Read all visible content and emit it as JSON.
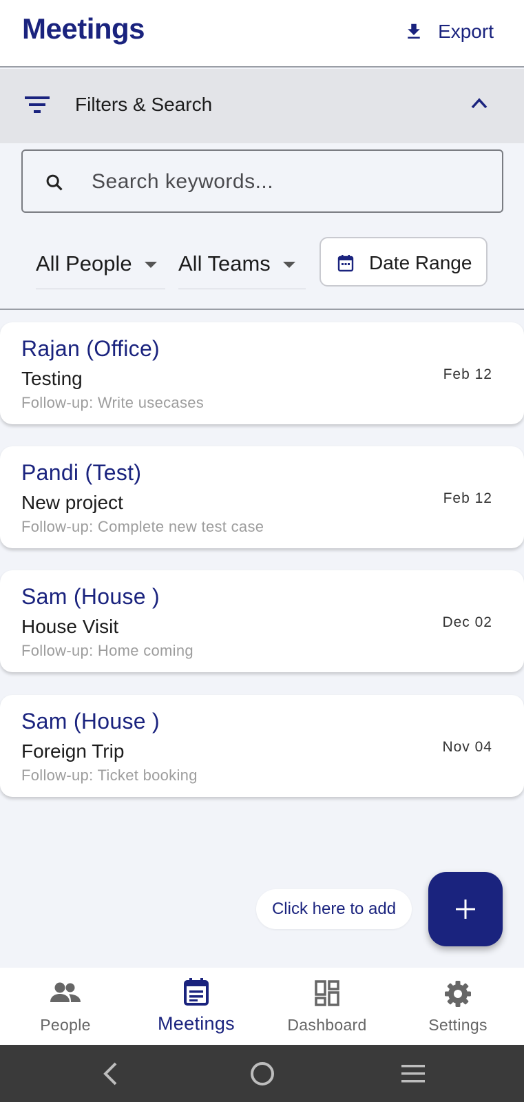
{
  "app_bar": {
    "title": "Meetings",
    "export_label": "Export"
  },
  "filters": {
    "header_label": "Filters & Search",
    "search_placeholder": "Search keywords...",
    "people_dropdown": "All People",
    "teams_dropdown": "All Teams",
    "date_range_label": "Date Range"
  },
  "meetings": [
    {
      "name": "Rajan (Office)",
      "title": "Testing",
      "followup": "Follow-up: Write usecases",
      "date": "Feb 12"
    },
    {
      "name": "Pandi (Test)",
      "title": "New project",
      "followup": "Follow-up: Complete new test case",
      "date": "Feb 12"
    },
    {
      "name": "Sam (House )",
      "title": "House Visit",
      "followup": "Follow-up: Home coming",
      "date": "Dec 02"
    },
    {
      "name": "Sam (House )",
      "title": "Foreign Trip",
      "followup": "Follow-up: Ticket booking",
      "date": "Nov 04"
    }
  ],
  "add_hint": "Click here to add",
  "bottom_nav": {
    "items": [
      {
        "label": "People",
        "icon": "people-icon"
      },
      {
        "label": "Meetings",
        "icon": "calendar-icon"
      },
      {
        "label": "Dashboard",
        "icon": "dashboard-icon"
      },
      {
        "label": "Settings",
        "icon": "gear-icon"
      }
    ],
    "active": "Meetings"
  },
  "colors": {
    "primary": "#1a237e",
    "background": "#f2f4f9",
    "filters_header_bg": "#e3e4e8",
    "followup_text": "#9d9d9d",
    "system_nav_bg": "#3a3a3a"
  }
}
